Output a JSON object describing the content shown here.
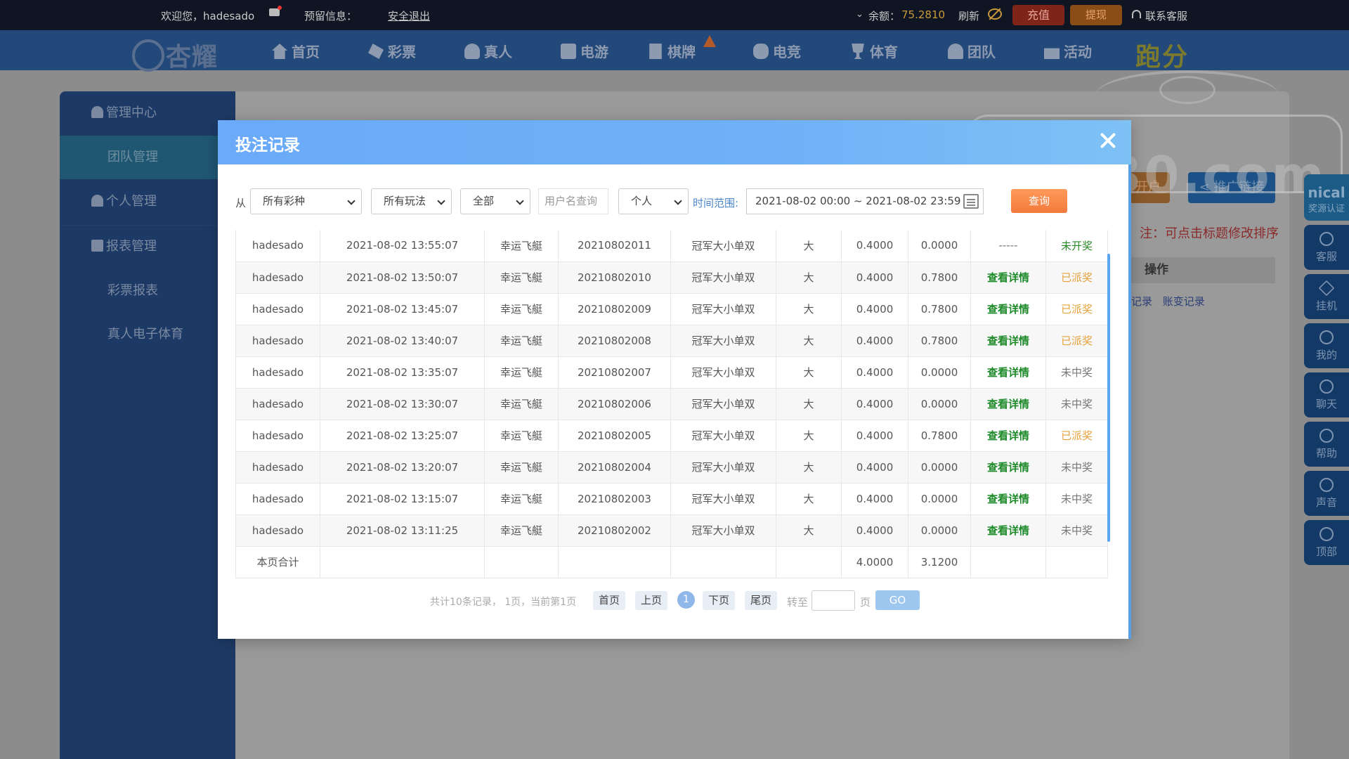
{
  "topbar": {
    "welcome": "欢迎您，hadesado",
    "reserve_info": "预留信息：",
    "logout": "安全退出",
    "balance_label": "余额：",
    "balance_value": "75.2810",
    "refresh": "刷新",
    "recharge": "充值",
    "withdraw": "提现",
    "support": "联系客服"
  },
  "nav": {
    "logo": "杏耀",
    "items": [
      "首页",
      "彩票",
      "真人",
      "电游",
      "棋牌",
      "电竞",
      "体育",
      "团队",
      "活动"
    ],
    "extra": "跑分"
  },
  "sidebar": {
    "items": [
      "管理中心",
      "团队管理",
      "个人管理",
      "报表管理",
      "彩票报表",
      "真人电子体育"
    ]
  },
  "background": {
    "open_account": "开户",
    "promo_link": "推广链接",
    "note": "注：可点击标题修改排序",
    "op_header": "操作",
    "links": [
      "记录",
      "账变记录"
    ],
    "watermark": "回家30.com",
    "corner": "nical",
    "corner_sub": "奖源认证"
  },
  "right_bar": {
    "items": [
      "客服",
      "挂机",
      "我的",
      "聊天",
      "帮助",
      "声音",
      "顶部"
    ]
  },
  "modal": {
    "title": "投注记录",
    "filters": {
      "from_label": "从",
      "lottery": "所有彩种",
      "play": "所有玩法",
      "status": "全部",
      "username_placeholder": "用户名查询",
      "scope": "个人",
      "time_label": "时间范围:",
      "date_range": "2021-08-02 00:00 ~ 2021-08-02 23:59",
      "query": "查询"
    },
    "rows": [
      [
        "hadesado",
        "2021-08-02 13:55:07",
        "幸运飞艇",
        "20210802011",
        "冠军大小单双",
        "大",
        "0.4000",
        "0.0000",
        "-----",
        "未开奖"
      ],
      [
        "hadesado",
        "2021-08-02 13:50:07",
        "幸运飞艇",
        "20210802010",
        "冠军大小单双",
        "大",
        "0.4000",
        "0.7800",
        "查看详情",
        "已派奖"
      ],
      [
        "hadesado",
        "2021-08-02 13:45:07",
        "幸运飞艇",
        "20210802009",
        "冠军大小单双",
        "大",
        "0.4000",
        "0.7800",
        "查看详情",
        "已派奖"
      ],
      [
        "hadesado",
        "2021-08-02 13:40:07",
        "幸运飞艇",
        "20210802008",
        "冠军大小单双",
        "大",
        "0.4000",
        "0.7800",
        "查看详情",
        "已派奖"
      ],
      [
        "hadesado",
        "2021-08-02 13:35:07",
        "幸运飞艇",
        "20210802007",
        "冠军大小单双",
        "大",
        "0.4000",
        "0.0000",
        "查看详情",
        "未中奖"
      ],
      [
        "hadesado",
        "2021-08-02 13:30:07",
        "幸运飞艇",
        "20210802006",
        "冠军大小单双",
        "大",
        "0.4000",
        "0.0000",
        "查看详情",
        "未中奖"
      ],
      [
        "hadesado",
        "2021-08-02 13:25:07",
        "幸运飞艇",
        "20210802005",
        "冠军大小单双",
        "大",
        "0.4000",
        "0.7800",
        "查看详情",
        "已派奖"
      ],
      [
        "hadesado",
        "2021-08-02 13:20:07",
        "幸运飞艇",
        "20210802004",
        "冠军大小单双",
        "大",
        "0.4000",
        "0.0000",
        "查看详情",
        "未中奖"
      ],
      [
        "hadesado",
        "2021-08-02 13:15:07",
        "幸运飞艇",
        "20210802003",
        "冠军大小单双",
        "大",
        "0.4000",
        "0.0000",
        "查看详情",
        "未中奖"
      ],
      [
        "hadesado",
        "2021-08-02 13:11:25",
        "幸运飞艇",
        "20210802002",
        "冠军大小单双",
        "大",
        "0.4000",
        "0.0000",
        "查看详情",
        "未中奖"
      ]
    ],
    "summary": {
      "label": "本页合计",
      "bet_total": "4.0000",
      "win_total": "3.1200"
    },
    "pager": {
      "info": "共计10条记录， 1页，当前第1页",
      "first": "首页",
      "prev": "上页",
      "current": "1",
      "next": "下页",
      "last": "尾页",
      "goto": "转至",
      "page_unit": "页",
      "go": "GO"
    }
  }
}
